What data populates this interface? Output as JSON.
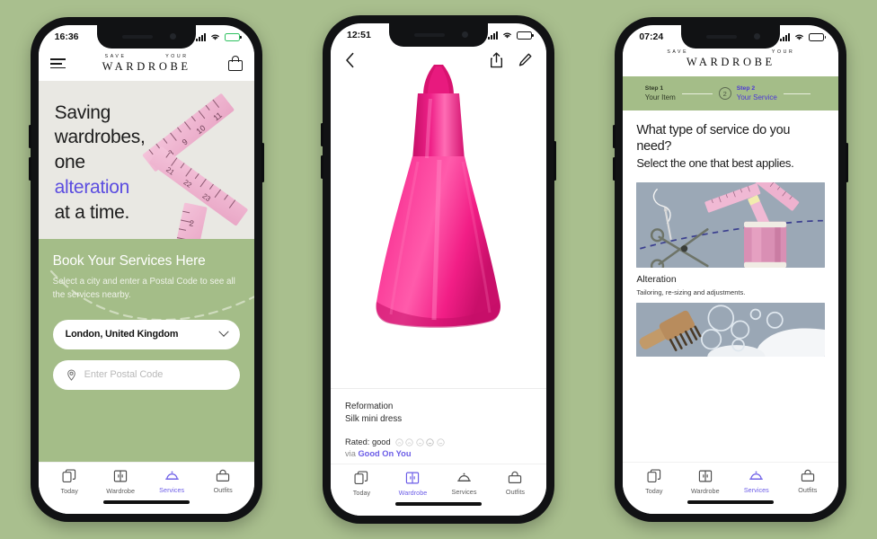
{
  "background_color": "#a9bf8e",
  "brand": {
    "logo_top_left": "SAVE",
    "logo_top_right": "YOUR",
    "logo_main": "WARDROBE",
    "accent_purple": "#6b5ce7",
    "green": "#a4bd88",
    "hero_bg": "#e9e8e3",
    "dress_pink": "#f0268a"
  },
  "tabs": [
    {
      "label": "Today",
      "icon": "today-cards-icon"
    },
    {
      "label": "Wardrobe",
      "icon": "wardrobe-closet-icon"
    },
    {
      "label": "Services",
      "icon": "services-bell-icon"
    },
    {
      "label": "Outfits",
      "icon": "outfits-hanger-bag-icon"
    }
  ],
  "phone1": {
    "status": {
      "time": "16:36",
      "signal": "signal-bars-icon",
      "wifi": "wifi-icon",
      "battery": "battery-charging-icon"
    },
    "header": {
      "menu": "hamburger-menu-icon",
      "bag": "shopping-bag-icon"
    },
    "hero": {
      "line1": "Saving",
      "line2": "wardrobes,",
      "line3": "one",
      "accent": "alteration",
      "line4": "at a time.",
      "image": "pink-measuring-tape"
    },
    "booking": {
      "title": "Book Your Services Here",
      "subtitle": "Select a city and enter a Postal Code to see all the services nearby.",
      "city_value": "London, United Kingdom",
      "city_chevron": "chevron-down-icon",
      "postal_placeholder": "Enter Postal Code",
      "postal_value": "",
      "postal_icon": "location-pin-icon"
    },
    "active_tab": "Services"
  },
  "phone2": {
    "status": {
      "time": "12:51",
      "signal": "signal-bars-icon",
      "wifi": "wifi-icon",
      "battery": "battery-icon"
    },
    "nav": {
      "back": "chevron-left-icon",
      "share": "share-upload-icon",
      "edit": "pencil-edit-icon"
    },
    "product": {
      "image": "pink-silk-mini-dress",
      "brand": "Reformation",
      "name": "Silk mini dress",
      "rating_label": "Rated: good",
      "rating_faces": 5,
      "rating_filled_index": 3,
      "via_prefix": "via ",
      "via_source": "Good On You"
    },
    "active_tab": "Wardrobe"
  },
  "phone3": {
    "status": {
      "time": "07:24",
      "signal": "signal-bars-icon",
      "wifi": "wifi-icon",
      "battery": "battery-icon"
    },
    "stepper": [
      {
        "step": "Step 1",
        "label": "Your Item",
        "active": false,
        "badge": ""
      },
      {
        "step": "Step 2",
        "label": "Your Service",
        "active": true,
        "badge": "2"
      }
    ],
    "question": "What type of service do you need?",
    "question_sub": "Select the one that best applies.",
    "services": [
      {
        "name": "Alteration",
        "desc": "Tailoring, re-sizing and adjustments.",
        "image": "sewing-tools-scissors-thread-tape"
      },
      {
        "name": "",
        "desc": "",
        "image": "cleaning-brush-bubbles"
      }
    ],
    "active_tab": "Services"
  }
}
